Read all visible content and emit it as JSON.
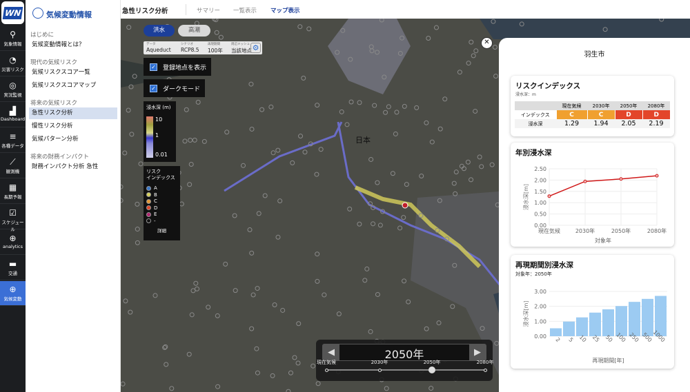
{
  "rail": {
    "items": [
      {
        "icon": "map-pin-icon",
        "label": "気象情報"
      },
      {
        "icon": "gauge-icon",
        "label": "災害リスク"
      },
      {
        "icon": "camera-focus-icon",
        "label": "実況監視"
      },
      {
        "icon": "dashboard-chart-icon",
        "label": "Dashboard"
      },
      {
        "icon": "database-icon",
        "label": "各種データ"
      },
      {
        "icon": "line-chart-icon",
        "label": "観測機"
      },
      {
        "icon": "calendar-icon",
        "label": "長期予報"
      },
      {
        "icon": "schedule-icon",
        "label": "スケジュール"
      },
      {
        "icon": "analytics-icon",
        "label": "analytics"
      },
      {
        "icon": "truck-icon",
        "label": "交通"
      },
      {
        "icon": "globe-icon",
        "label": "気候変動"
      }
    ],
    "logo": "WN"
  },
  "submenu": {
    "title": "気候変動情報",
    "sections": [
      {
        "label": "はじめに",
        "items": [
          "気候変動情報とは？"
        ]
      },
      {
        "label": "現代の気候リスク",
        "items": [
          "気候リスクスコア一覧",
          "気候リスクスコアマップ"
        ]
      },
      {
        "label": "将来の気候リスク",
        "items": [
          "急性リスク分析",
          "慢性リスク分析",
          "気候パターン分析"
        ]
      },
      {
        "label": "将来の財務インパクト",
        "items": [
          "財務インパクト分析 急性"
        ]
      }
    ],
    "selected": "急性リスク分析"
  },
  "header": {
    "title": "急性リスク分析",
    "tabs": [
      "サマリー",
      "一覧表示",
      "マップ表示"
    ],
    "active_tab": "マップ表示"
  },
  "map": {
    "hazard_buttons": [
      "洪水",
      "高潮"
    ],
    "active_hazard": "洪水",
    "info": [
      {
        "label": "データ",
        "value": "Aqueduct"
      },
      {
        "label": "シナリオ",
        "value": "RCP8.5"
      },
      {
        "label": "再現期間",
        "value": "100年"
      },
      {
        "label": "周辺メッシュ",
        "value": "当該地点"
      }
    ],
    "checkboxes": [
      {
        "label": "登録地点を表示",
        "checked": true
      },
      {
        "label": "ダークモード",
        "checked": true
      }
    ],
    "depth_legend": {
      "title": "浸水深 (m)",
      "ticks": [
        "10",
        "1",
        "0.01"
      ]
    },
    "risk_legend": {
      "title": "リスク\nインデックス",
      "items": [
        {
          "label": "A",
          "color": "#3a78c8"
        },
        {
          "label": "B",
          "color": "#d8d25a"
        },
        {
          "label": "C",
          "color": "#e49a35"
        },
        {
          "label": "D",
          "color": "#e0482a"
        },
        {
          "label": "E",
          "color": "#b0246e"
        },
        {
          "label": "-",
          "color": "#111111"
        }
      ],
      "detail": "詳細"
    },
    "place_label": "日本",
    "timeline": {
      "current": "2050年",
      "stops": [
        "現在気候",
        "2030年",
        "2050年",
        "2080年"
      ],
      "selected_index": 2
    }
  },
  "panel": {
    "city": "羽生市",
    "risk_index": {
      "title": "リスクインデックス",
      "subtitle": "浸水深：m",
      "columns": [
        "現在気候",
        "2030年",
        "2050年",
        "2080年"
      ],
      "row_labels": [
        "インデックス",
        "浸水深"
      ],
      "index": [
        "C",
        "C",
        "D",
        "D"
      ],
      "index_colors": [
        "#f0a030",
        "#f0a030",
        "#e3452a",
        "#e3452a"
      ],
      "depth": [
        "1.29",
        "1.94",
        "2.05",
        "2.19"
      ]
    }
  },
  "chart_data": [
    {
      "type": "line",
      "title": "年別浸水深",
      "categories": [
        "現在気候",
        "2030年",
        "2050年",
        "2080年"
      ],
      "values": [
        1.29,
        1.94,
        2.05,
        2.19
      ],
      "xlabel": "対象年",
      "ylabel": "浸水深[m]",
      "ylim": [
        0,
        2.5
      ],
      "yticks": [
        "0.00",
        "0.50",
        "1.00",
        "1.50",
        "2.00",
        "2.50"
      ],
      "color": "#d01818"
    },
    {
      "type": "bar",
      "title": "再現期間別浸水深",
      "subtitle": "対象年：2050年",
      "categories": [
        "2",
        "5",
        "10",
        "25",
        "50",
        "100",
        "250",
        "500",
        "1000"
      ],
      "values": [
        0.53,
        0.98,
        1.26,
        1.58,
        1.8,
        2.02,
        2.3,
        2.5,
        2.7
      ],
      "xlabel": "再現期間[年]",
      "ylabel": "浸水深[m]",
      "ylim": [
        0,
        3
      ],
      "yticks": [
        "0.00",
        "1.00",
        "2.00",
        "3.00"
      ],
      "color": "#9ccbf2"
    }
  ]
}
